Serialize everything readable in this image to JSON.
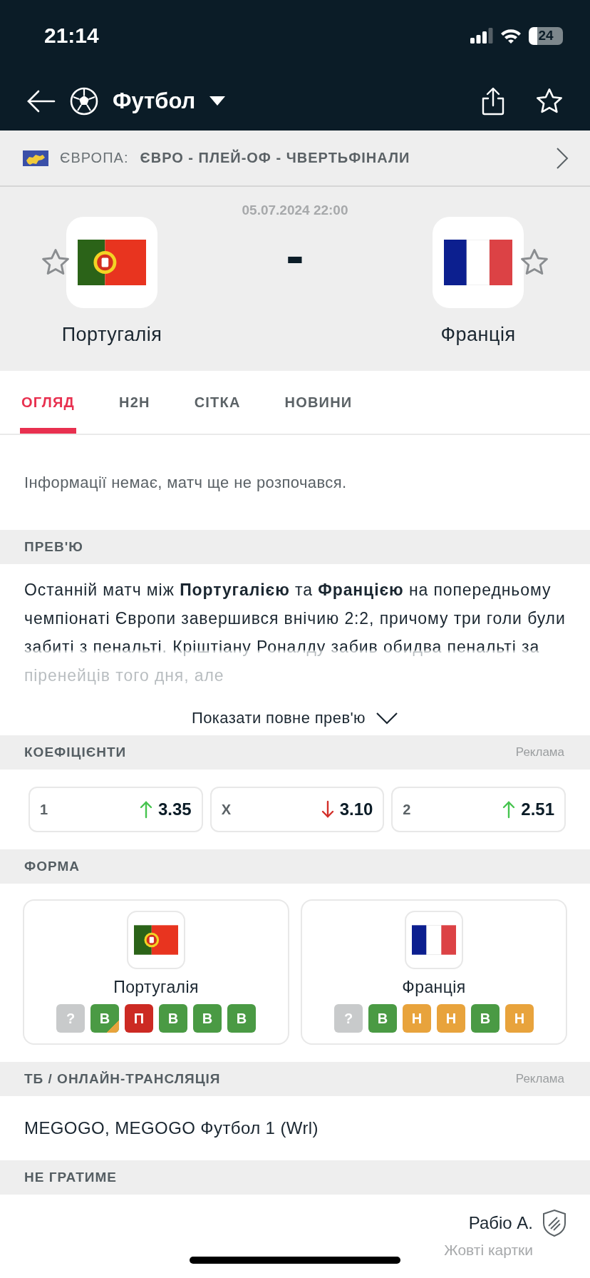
{
  "status_bar": {
    "time": "21:14",
    "battery": "24"
  },
  "nav": {
    "title": "Футбол",
    "favorite": false
  },
  "breadcrumb": {
    "region": "ЄВРОПА:",
    "competition": "ЄВРО - ПЛЕЙ-ОФ - ЧВЕРТЬФІНАЛИ"
  },
  "match": {
    "datetime": "05.07.2024 22:00",
    "score": "-",
    "home": {
      "name": "Португалія",
      "flag": {
        "kind": "portugal"
      },
      "favorite": false
    },
    "away": {
      "name": "Франція",
      "flag": {
        "kind": "france"
      },
      "favorite": false
    }
  },
  "tabs": [
    {
      "label": "ОГЛЯД",
      "selected": true
    },
    {
      "label": "H2H",
      "selected": false
    },
    {
      "label": "СІТКА",
      "selected": false
    },
    {
      "label": "НОВИНИ",
      "selected": false
    }
  ],
  "info": "Інформації немає, матч ще не розпочався.",
  "preview": {
    "title": "ПРЕВ'Ю",
    "text": "Останній матч між **Португалією** та **Францією** на попередньому чемпіонаті Європи завершився внічию 2:2, причому три голи були забиті з пенальті. Кріштіану Роналду забив обидва пенальті за піренейців того дня, але",
    "more": "Показати повне прев'ю"
  },
  "odds": {
    "title": "КОЕФІЦІЄНТИ",
    "ad": "Реклама",
    "items": [
      {
        "label": "1",
        "value": "3.35",
        "kind": "up"
      },
      {
        "label": "X",
        "value": "3.10",
        "kind": "down"
      },
      {
        "label": "2",
        "value": "2.51",
        "kind": "up"
      }
    ]
  },
  "form": {
    "title": "ФОРМА",
    "teams": [
      {
        "name": "Португалія",
        "flag": {
          "kind": "portugal"
        },
        "results": [
          {
            "label": "?",
            "color": "#c8cacb",
            "penalty": false
          },
          {
            "label": "В",
            "color": "#4a9a44",
            "penalty": true
          },
          {
            "label": "П",
            "color": "#cc2a23",
            "penalty": false
          },
          {
            "label": "В",
            "color": "#4a9a44",
            "penalty": false
          },
          {
            "label": "В",
            "color": "#4a9a44",
            "penalty": false
          },
          {
            "label": "В",
            "color": "#4a9a44",
            "penalty": false
          }
        ]
      },
      {
        "name": "Франція",
        "flag": {
          "kind": "france"
        },
        "results": [
          {
            "label": "?",
            "color": "#c8cacb",
            "penalty": false
          },
          {
            "label": "В",
            "color": "#4a9a44",
            "penalty": false
          },
          {
            "label": "Н",
            "color": "#e8a33c",
            "penalty": false
          },
          {
            "label": "Н",
            "color": "#e8a33c",
            "penalty": false
          },
          {
            "label": "В",
            "color": "#4a9a44",
            "penalty": false
          },
          {
            "label": "Н",
            "color": "#e8a33c",
            "penalty": false
          }
        ]
      }
    ]
  },
  "tv": {
    "title": "ТБ / ОНЛАЙН-ТРАНСЛЯЦІЯ",
    "ad": "Реклама",
    "channels": "MEGOGO, MEGOGO Футбол 1 (Wrl)"
  },
  "missing": {
    "title": "НЕ ГРАТИМЕ",
    "players": [
      {
        "name": "Рабіо А.",
        "reason": "Жовті картки"
      }
    ]
  }
}
